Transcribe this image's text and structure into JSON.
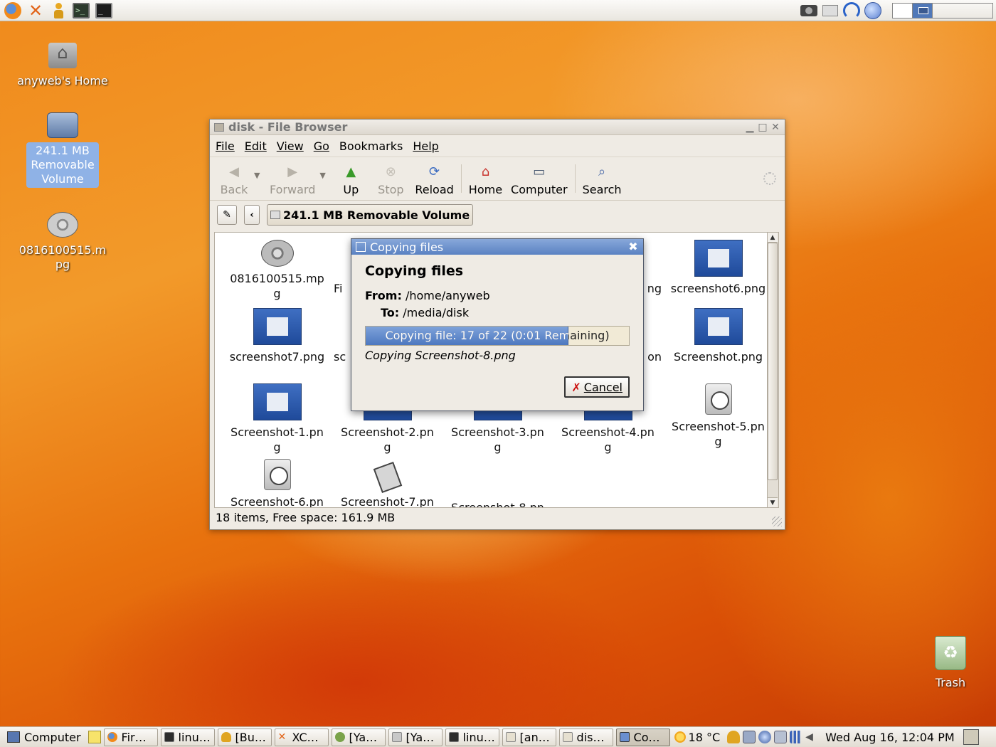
{
  "desktop": {
    "icons": [
      {
        "label": "anyweb's Home",
        "icon": "home-folder-icon"
      },
      {
        "label": "241.1 MB Removable Volume",
        "icon": "removable-drive-icon"
      },
      {
        "label": "0816100515.mpg",
        "icon": "video-file-icon"
      },
      {
        "label": "Trash",
        "icon": "trash-icon"
      }
    ]
  },
  "top_panel": {
    "launchers": [
      "firefox-icon",
      "xchat-icon",
      "gaim-icon",
      "terminal-icon",
      "console-icon"
    ],
    "tray": [
      "camera-icon",
      "package-icon",
      "network-icon",
      "globe-icon"
    ]
  },
  "file_browser": {
    "title": "disk - File Browser",
    "menu": [
      "File",
      "Edit",
      "View",
      "Go",
      "Bookmarks",
      "Help"
    ],
    "toolbar": {
      "back": "Back",
      "forward": "Forward",
      "up": "Up",
      "stop": "Stop",
      "reload": "Reload",
      "home": "Home",
      "computer": "Computer",
      "search": "Search"
    },
    "location": "241.1 MB Removable Volume",
    "files": [
      {
        "name": "0816100515.mp\ng",
        "type": "video"
      },
      {
        "name": "Fi",
        "type": "hidden"
      },
      {
        "name": "",
        "type": "hidden"
      },
      {
        "name": "ng",
        "type": "hidden"
      },
      {
        "name": "screenshot6.png",
        "type": "screenshot"
      },
      {
        "name": "screenshot7.png",
        "type": "screenshot"
      },
      {
        "name": "sc",
        "type": "hidden"
      },
      {
        "name": "",
        "type": "hidden"
      },
      {
        "name": "on",
        "type": "hidden"
      },
      {
        "name": "Screenshot.png",
        "type": "screenshot"
      },
      {
        "name": "Screenshot-1.pn\ng",
        "type": "screenshot"
      },
      {
        "name": "Screenshot-2.pn\ng",
        "type": "screenshot"
      },
      {
        "name": "Screenshot-3.pn\ng",
        "type": "screenshot"
      },
      {
        "name": "Screenshot-4.pn\ng",
        "type": "screenshot"
      },
      {
        "name": "Screenshot-5.pn\ng",
        "type": "clock"
      },
      {
        "name": "Screenshot-6.pn",
        "type": "clock"
      },
      {
        "name": "Screenshot-7.pn",
        "type": "document"
      },
      {
        "name": "Screenshot-8.pn",
        "type": "partial"
      }
    ],
    "status": "18 items, Free space: 161.9 MB"
  },
  "copy_dialog": {
    "title": "Copying files",
    "heading": "Copying files",
    "from_label": "From:",
    "from_value": "/home/anyweb",
    "to_label": "To:",
    "to_value": "/media/disk",
    "progress_text": "Copying file: 17 of 22 (0:01 Remaining)",
    "progress_fraction": 0.77,
    "current_file": "Copying Screenshot-8.png",
    "cancel": "Cancel"
  },
  "bottom_panel": {
    "computer_menu": "Computer",
    "tasks": [
      {
        "label": "Fir…",
        "icon": "ti-ff"
      },
      {
        "label": "linu…",
        "icon": "ti-term"
      },
      {
        "label": "[Bu…",
        "icon": "ti-person"
      },
      {
        "label": "XC…",
        "icon": "ti-x"
      },
      {
        "label": "[Ya…",
        "icon": "ti-yast"
      },
      {
        "label": "[Ya…",
        "icon": "ti-yast2"
      },
      {
        "label": "linu…",
        "icon": "ti-term"
      },
      {
        "label": "[an…",
        "icon": "ti-folder"
      },
      {
        "label": "dis…",
        "icon": "ti-folder"
      },
      {
        "label": "Co…",
        "icon": "ti-dialog",
        "active": true
      }
    ],
    "weather": "18 °C",
    "clock": "Wed Aug 16, 12:04 PM"
  }
}
